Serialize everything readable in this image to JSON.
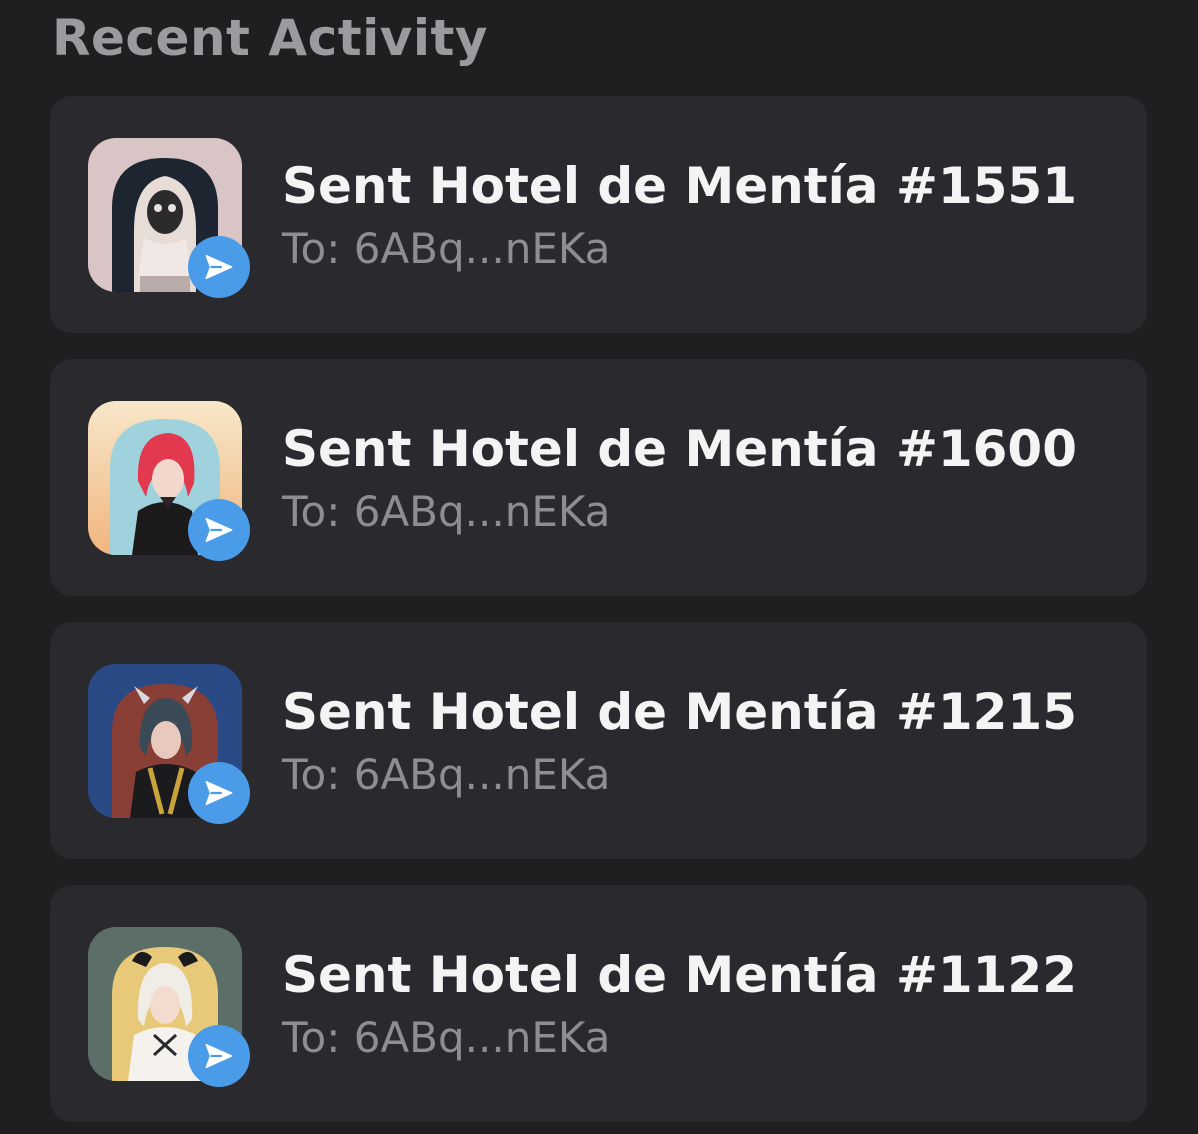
{
  "section": {
    "title": "Recent Activity"
  },
  "activities": [
    {
      "title": "Sent Hotel de Mentía #1551",
      "recipient": "To: 6ABq...nEKa",
      "badge_icon": "send-icon",
      "thumb_bg": "#d9c5c6"
    },
    {
      "title": "Sent Hotel de Mentía #1600",
      "recipient": "To: 6ABq...nEKa",
      "badge_icon": "send-icon",
      "thumb_bg": "#f3d9b0"
    },
    {
      "title": "Sent Hotel de Mentía #1215",
      "recipient": "To: 6ABq...nEKa",
      "badge_icon": "send-icon",
      "thumb_bg": "#2a4a86"
    },
    {
      "title": "Sent Hotel de Mentía #1122",
      "recipient": "To: 6ABq...nEKa",
      "badge_icon": "send-icon",
      "thumb_bg": "#5c6e68"
    }
  ],
  "colors": {
    "background": "#1f1f21",
    "card": "#2a2a2e",
    "badge": "#4a9ce8",
    "title_text": "#f4f4f5",
    "muted_text": "#8d8d92"
  }
}
